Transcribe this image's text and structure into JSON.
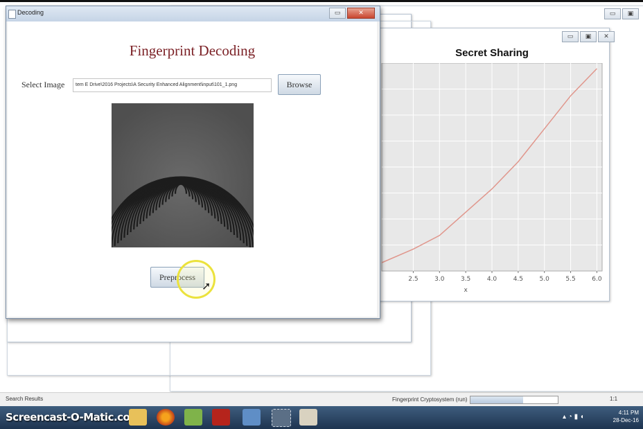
{
  "decoding_window": {
    "title": "Decoding",
    "heading": "Fingerprint Decoding",
    "select_label": "Select Image",
    "path_value": "tem E Drive\\2016 Projects\\A Security Enhanced Alignment\\input\\101_1.png",
    "browse_label": "Browse",
    "preprocess_label": "Preprocess"
  },
  "chart_window": {
    "title": "Secret Sharing"
  },
  "chart_data": {
    "type": "line",
    "title": "Secret Sharing",
    "xlabel": "x",
    "ylabel": "",
    "xticks": [
      "2.5",
      "3.0",
      "3.5",
      "4.0",
      "4.5",
      "5.0",
      "5.5",
      "6.0"
    ],
    "xlim": [
      1.9,
      6.1
    ],
    "grid": true,
    "series": [
      {
        "color": "#e0968c",
        "x": [
          1.9,
          2.5,
          3.0,
          3.5,
          4.0,
          4.5,
          5.0,
          5.5,
          6.0
        ],
        "y": [
          0.0,
          0.07,
          0.14,
          0.26,
          0.38,
          0.52,
          0.69,
          0.86,
          1.0
        ]
      }
    ]
  },
  "statusbar": {
    "search_results": "Search Results",
    "task": "Fingerprint Cryptosystem (run)",
    "progress": 0.6,
    "position": "1:1"
  },
  "taskbar": {
    "watermark": "Screencast-O-Matic.com",
    "time": "4:11 PM",
    "date": "28-Dec-16",
    "icons": [
      "folder-icon",
      "firefox-icon",
      "notepad-icon",
      "pdf-icon",
      "virtualbox-icon",
      "snipping-icon",
      "java-icon"
    ]
  },
  "colors": {
    "heading": "#7a1f24",
    "plot_bg": "#e8e8e8",
    "line": "#e0968c",
    "taskbar": "#2a4666"
  }
}
